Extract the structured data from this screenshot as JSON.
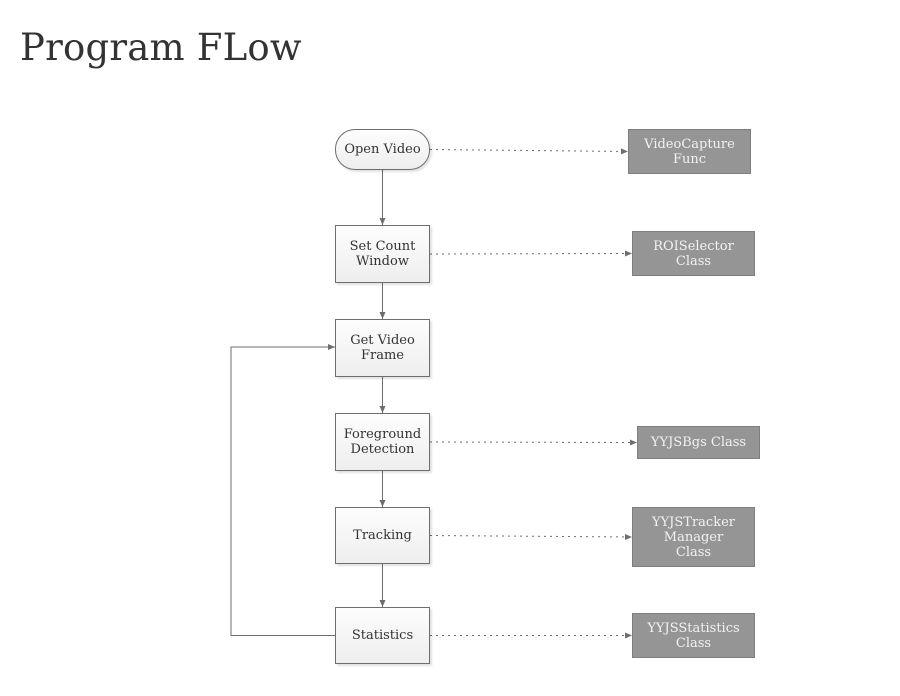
{
  "title": "Program FLow",
  "flow_nodes": [
    {
      "id": "open-video",
      "label": "Open Video",
      "shape": "terminal"
    },
    {
      "id": "set-count-window",
      "label": "Set Count\nWindow",
      "shape": "process"
    },
    {
      "id": "get-video-frame",
      "label": "Get Video\nFrame",
      "shape": "process"
    },
    {
      "id": "foreground-detection",
      "label": "Foreground\nDetection",
      "shape": "process"
    },
    {
      "id": "tracking",
      "label": "Tracking",
      "shape": "process"
    },
    {
      "id": "statistics",
      "label": "Statistics",
      "shape": "process"
    }
  ],
  "class_nodes": [
    {
      "id": "videocapture-func",
      "label": "VideoCapture\nFunc",
      "linked_to": "open-video"
    },
    {
      "id": "roiselector-class",
      "label": "ROISelector\nClass",
      "linked_to": "set-count-window"
    },
    {
      "id": "yyjsbgs-class",
      "label": "YYJSBgs Class",
      "linked_to": "foreground-detection"
    },
    {
      "id": "yyjstracker-manager-class",
      "label": "YYJSTracker\nManager\nClass",
      "linked_to": "tracking"
    },
    {
      "id": "yyjsstatistics-class",
      "label": "YYJSStatistics\nClass",
      "linked_to": "statistics"
    }
  ],
  "edges": [
    {
      "from": "open-video",
      "to": "set-count-window",
      "style": "solid"
    },
    {
      "from": "set-count-window",
      "to": "get-video-frame",
      "style": "solid"
    },
    {
      "from": "get-video-frame",
      "to": "foreground-detection",
      "style": "solid"
    },
    {
      "from": "foreground-detection",
      "to": "tracking",
      "style": "solid"
    },
    {
      "from": "tracking",
      "to": "statistics",
      "style": "solid"
    },
    {
      "from": "statistics",
      "to": "get-video-frame",
      "style": "solid",
      "kind": "loop"
    },
    {
      "from": "open-video",
      "to": "videocapture-func",
      "style": "dotted"
    },
    {
      "from": "set-count-window",
      "to": "roiselector-class",
      "style": "dotted"
    },
    {
      "from": "foreground-detection",
      "to": "yyjsbgs-class",
      "style": "dotted"
    },
    {
      "from": "tracking",
      "to": "yyjstracker-manager-class",
      "style": "dotted"
    },
    {
      "from": "statistics",
      "to": "yyjsstatistics-class",
      "style": "dotted"
    }
  ],
  "colors": {
    "line": "#6e6e6e",
    "class_fill": "#959595",
    "class_text": "#f2f2f2",
    "node_text": "#333333"
  }
}
